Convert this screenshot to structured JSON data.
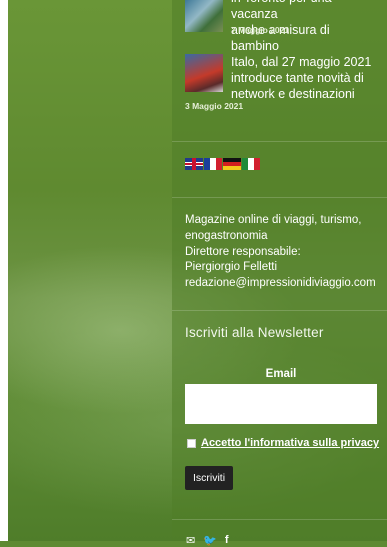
{
  "posts": [
    {
      "title_lines": [
        "in Toronto per una vacanza",
        "anche a misura di bambino"
      ],
      "date": "7 Maggio 2021"
    },
    {
      "title_lines": [
        "Italo, dal 27 maggio 2021",
        "introduce tante novità di",
        "network e destinazioni"
      ],
      "date": "3 Maggio 2021"
    }
  ],
  "languages": [
    "english-flag-icon",
    "french-flag-icon",
    "german-flag-icon",
    "italian-flag-icon"
  ],
  "info": {
    "line1": "Magazine online di viaggi, turismo,",
    "line2": "enogastronomia",
    "line3": "Direttore responsabile:",
    "line4": "Piergiorgio Felletti",
    "line5": "redazione@impressionidiviaggio.com"
  },
  "newsletter": {
    "title": "Iscriviti alla Newsletter",
    "email_label": "Email",
    "email_value": "",
    "privacy_label": "Accetto l'informativa sulla privacy",
    "submit_label": "Iscriviti"
  },
  "social": [
    "email-icon",
    "twitter-icon",
    "facebook-icon"
  ],
  "colors": {
    "background": "#5e8a32",
    "button": "#222222"
  }
}
